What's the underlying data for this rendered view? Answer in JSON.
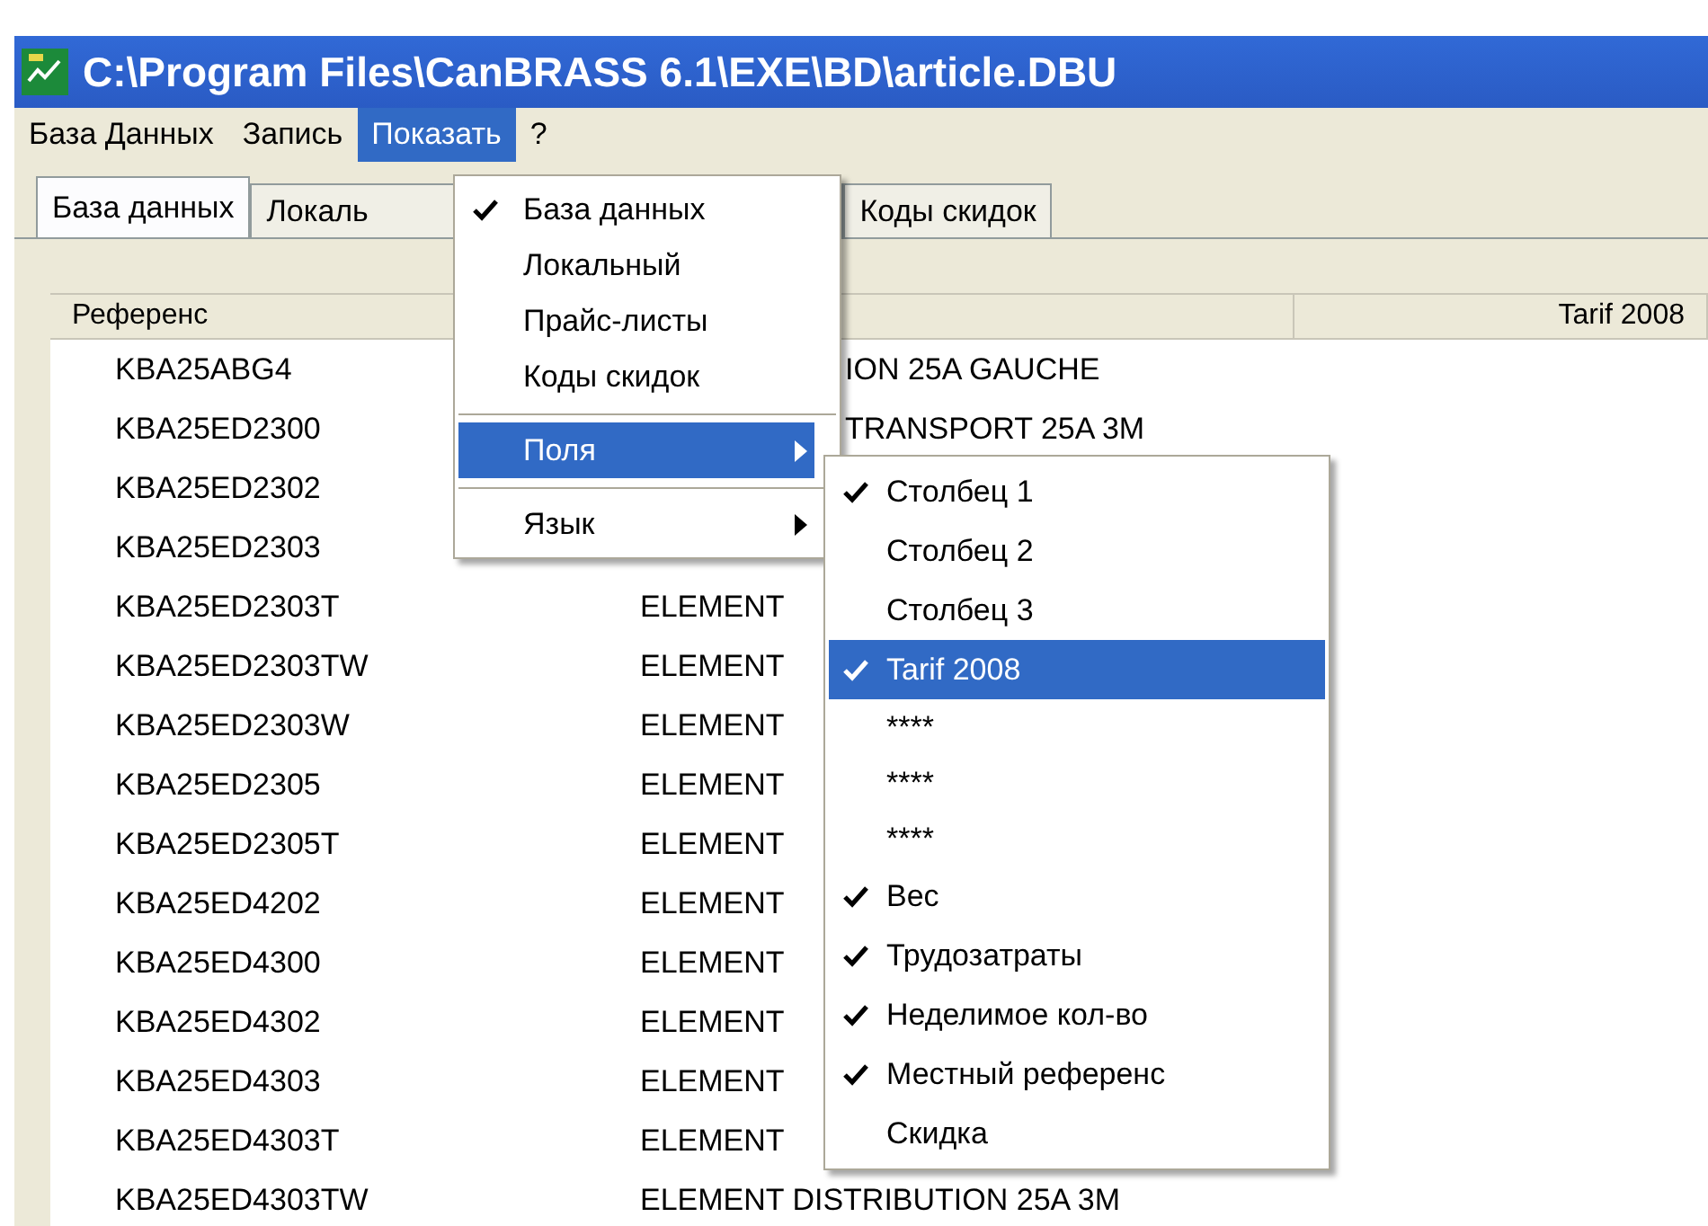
{
  "window": {
    "title": "C:\\Program Files\\CanBRASS 6.1\\EXE\\BD\\article.DBU"
  },
  "menu_bar": [
    {
      "label": "База Данных",
      "selected": false
    },
    {
      "label": "Запись",
      "selected": false
    },
    {
      "label": "Показать",
      "selected": true
    },
    {
      "label": "?",
      "selected": false
    }
  ],
  "tabs": [
    {
      "label": "База данных",
      "selected": true,
      "cut": false
    },
    {
      "label": "Локаль",
      "selected": false,
      "cut": true
    },
    {
      "label": "Коды скидок",
      "selected": false,
      "cut": false
    }
  ],
  "table": {
    "column_headers": {
      "column_1": "Референс",
      "column_3": "Tarif 2008"
    },
    "rows": [
      {
        "reference": "KBA25ABG4",
        "column_2": "ION 25A GAUCHE",
        "kind": "partial"
      },
      {
        "reference": "KBA25ED2300",
        "column_2": "TRANSPORT  25A 3M",
        "kind": "partial"
      },
      {
        "reference": "KBA25ED2302"
      },
      {
        "reference": "KBA25ED2303"
      },
      {
        "reference": "KBA25ED2303T",
        "column_2": "ELEMENT",
        "kind": "plain"
      },
      {
        "reference": "KBA25ED2303TW",
        "column_2": "ELEMENT",
        "kind": "plain"
      },
      {
        "reference": "KBA25ED2303W",
        "column_2": "ELEMENT",
        "kind": "plain"
      },
      {
        "reference": "KBA25ED2305",
        "column_2": "ELEMENT",
        "kind": "plain"
      },
      {
        "reference": "KBA25ED2305T",
        "column_2": "ELEMENT",
        "kind": "plain"
      },
      {
        "reference": "KBA25ED4202",
        "column_2": "ELEMENT",
        "kind": "plain"
      },
      {
        "reference": "KBA25ED4300",
        "column_2": "ELEMENT",
        "kind": "plain"
      },
      {
        "reference": "KBA25ED4302",
        "column_2": "ELEMENT",
        "kind": "plain"
      },
      {
        "reference": "KBA25ED4303",
        "column_2": "ELEMENT",
        "kind": "plain"
      },
      {
        "reference": "KBA25ED4303T",
        "column_2": "ELEMENT",
        "kind": "plain"
      },
      {
        "reference": "KBA25ED4303TW",
        "column_2": "ELEMENT DISTRIBUTION  25A 3M",
        "kind": "plain"
      }
    ]
  },
  "dropdown": {
    "items": [
      {
        "kind": "item",
        "label": "База данных",
        "checked": true,
        "selected": false
      },
      {
        "kind": "item",
        "label": "Локальный",
        "checked": false,
        "selected": false
      },
      {
        "kind": "item",
        "label": "Прайс-листы",
        "checked": false,
        "selected": false
      },
      {
        "kind": "item",
        "label": "Коды скидок",
        "checked": false,
        "selected": false
      },
      {
        "kind": "separator"
      },
      {
        "kind": "submenu",
        "label": "Поля",
        "checked": false,
        "selected": true
      },
      {
        "kind": "separator"
      },
      {
        "kind": "submenu",
        "label": "Язык",
        "checked": false,
        "selected": false
      }
    ]
  },
  "submenu": {
    "items": [
      {
        "label": "Столбец 1",
        "checked": true,
        "selected": false
      },
      {
        "label": "Столбец 2",
        "checked": false,
        "selected": false
      },
      {
        "label": "Столбец 3",
        "checked": false,
        "selected": false
      },
      {
        "label": "Tarif 2008",
        "checked": true,
        "selected": true
      },
      {
        "label": "****",
        "checked": false,
        "selected": false
      },
      {
        "label": "****",
        "checked": false,
        "selected": false
      },
      {
        "label": "****",
        "checked": false,
        "selected": false
      },
      {
        "label": "Вес",
        "checked": true,
        "selected": false
      },
      {
        "label": "Трудозатраты",
        "checked": true,
        "selected": false
      },
      {
        "label": "Неделимое кол-во",
        "checked": true,
        "selected": false
      },
      {
        "label": "Местный референс",
        "checked": true,
        "selected": false
      },
      {
        "label": "Скидка",
        "checked": false,
        "selected": false
      }
    ]
  }
}
